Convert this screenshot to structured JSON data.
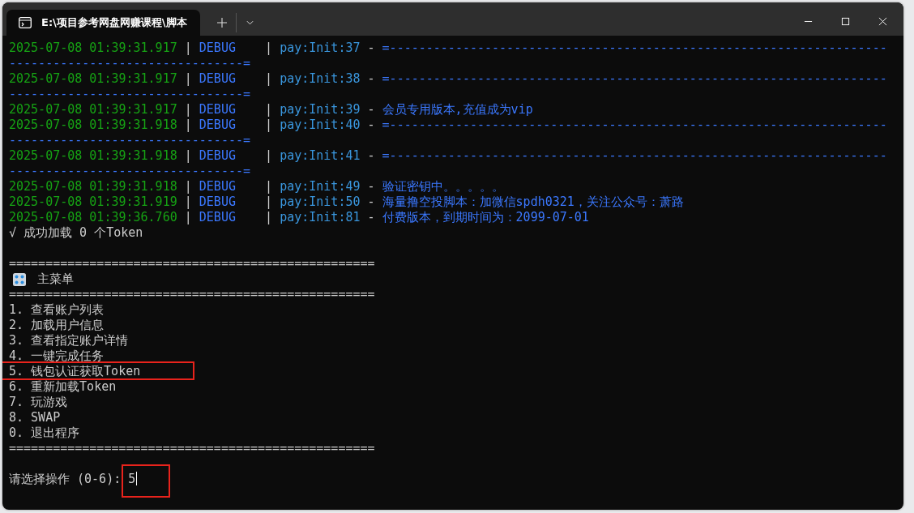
{
  "tab": {
    "title": "E:\\项目参考网盘网赚课程\\脚本",
    "selected": true
  },
  "logs": [
    {
      "time": "2025-07-08 01:39:31.917",
      "pipe_1": "|",
      "level": "DEBUG",
      "pipe_2": "|",
      "source": "pay:Init:37",
      "dash": "-",
      "message": "=--------------------------------------------------------------------",
      "continuation": "--------------------------------="
    },
    {
      "time": "2025-07-08 01:39:31.917",
      "pipe_1": "|",
      "level": "DEBUG",
      "pipe_2": "|",
      "source": "pay:Init:38",
      "dash": "-",
      "message": "=--------------------------------------------------------------------",
      "continuation": "--------------------------------="
    },
    {
      "time": "2025-07-08 01:39:31.917",
      "pipe_1": "|",
      "level": "DEBUG",
      "pipe_2": "|",
      "source": "pay:Init:39",
      "dash": "-",
      "message": "会员专用版本,充值成为vip"
    },
    {
      "time": "2025-07-08 01:39:31.918",
      "pipe_1": "|",
      "level": "DEBUG",
      "pipe_2": "|",
      "source": "pay:Init:40",
      "dash": "-",
      "message": "=--------------------------------------------------------------------",
      "continuation": "--------------------------------="
    },
    {
      "time": "2025-07-08 01:39:31.918",
      "pipe_1": "|",
      "level": "DEBUG",
      "pipe_2": "|",
      "source": "pay:Init:41",
      "dash": "-",
      "message": "=--------------------------------------------------------------------",
      "continuation": "--------------------------------="
    },
    {
      "time": "2025-07-08 01:39:31.918",
      "pipe_1": "|",
      "level": "DEBUG",
      "pipe_2": "|",
      "source": "pay:Init:49",
      "dash": "-",
      "message": "验证密钥中。。。。。"
    },
    {
      "time": "2025-07-08 01:39:31.919",
      "pipe_1": "|",
      "level": "DEBUG",
      "pipe_2": "|",
      "source": "pay:Init:50",
      "dash": "-",
      "message": "海量撸空投脚本：加微信spdh0321，关注公众号：萧路"
    },
    {
      "time": "2025-07-08 01:39:36.760",
      "pipe_1": "|",
      "level": "DEBUG",
      "pipe_2": "|",
      "source": "pay:Init:81",
      "dash": "-",
      "message": "付费版本，到期时间为：2099-07-01"
    }
  ],
  "status_line": "√ 成功加载 0 个Token",
  "menu": {
    "rule_top": "==================================================",
    "title": "主菜单",
    "rule_mid": "==================================================",
    "items": [
      {
        "label": "1. 查看账户列表",
        "highlighted": false
      },
      {
        "label": "2. 加载用户信息",
        "highlighted": false
      },
      {
        "label": "3. 查看指定账户详情",
        "highlighted": false
      },
      {
        "label": "4. 一键完成任务",
        "highlighted": false
      },
      {
        "label": "5. 钱包认证获取Token",
        "highlighted": true
      },
      {
        "label": "6. 重新加载Token",
        "highlighted": false
      },
      {
        "label": "7. 玩游戏",
        "highlighted": false
      },
      {
        "label": "8. SWAP",
        "highlighted": false
      },
      {
        "label": "0. 退出程序",
        "highlighted": false
      }
    ],
    "rule_bottom": "=================================================="
  },
  "prompt": {
    "label": "请选择操作 (0-6): ",
    "value": "5",
    "highlighted": true
  }
}
